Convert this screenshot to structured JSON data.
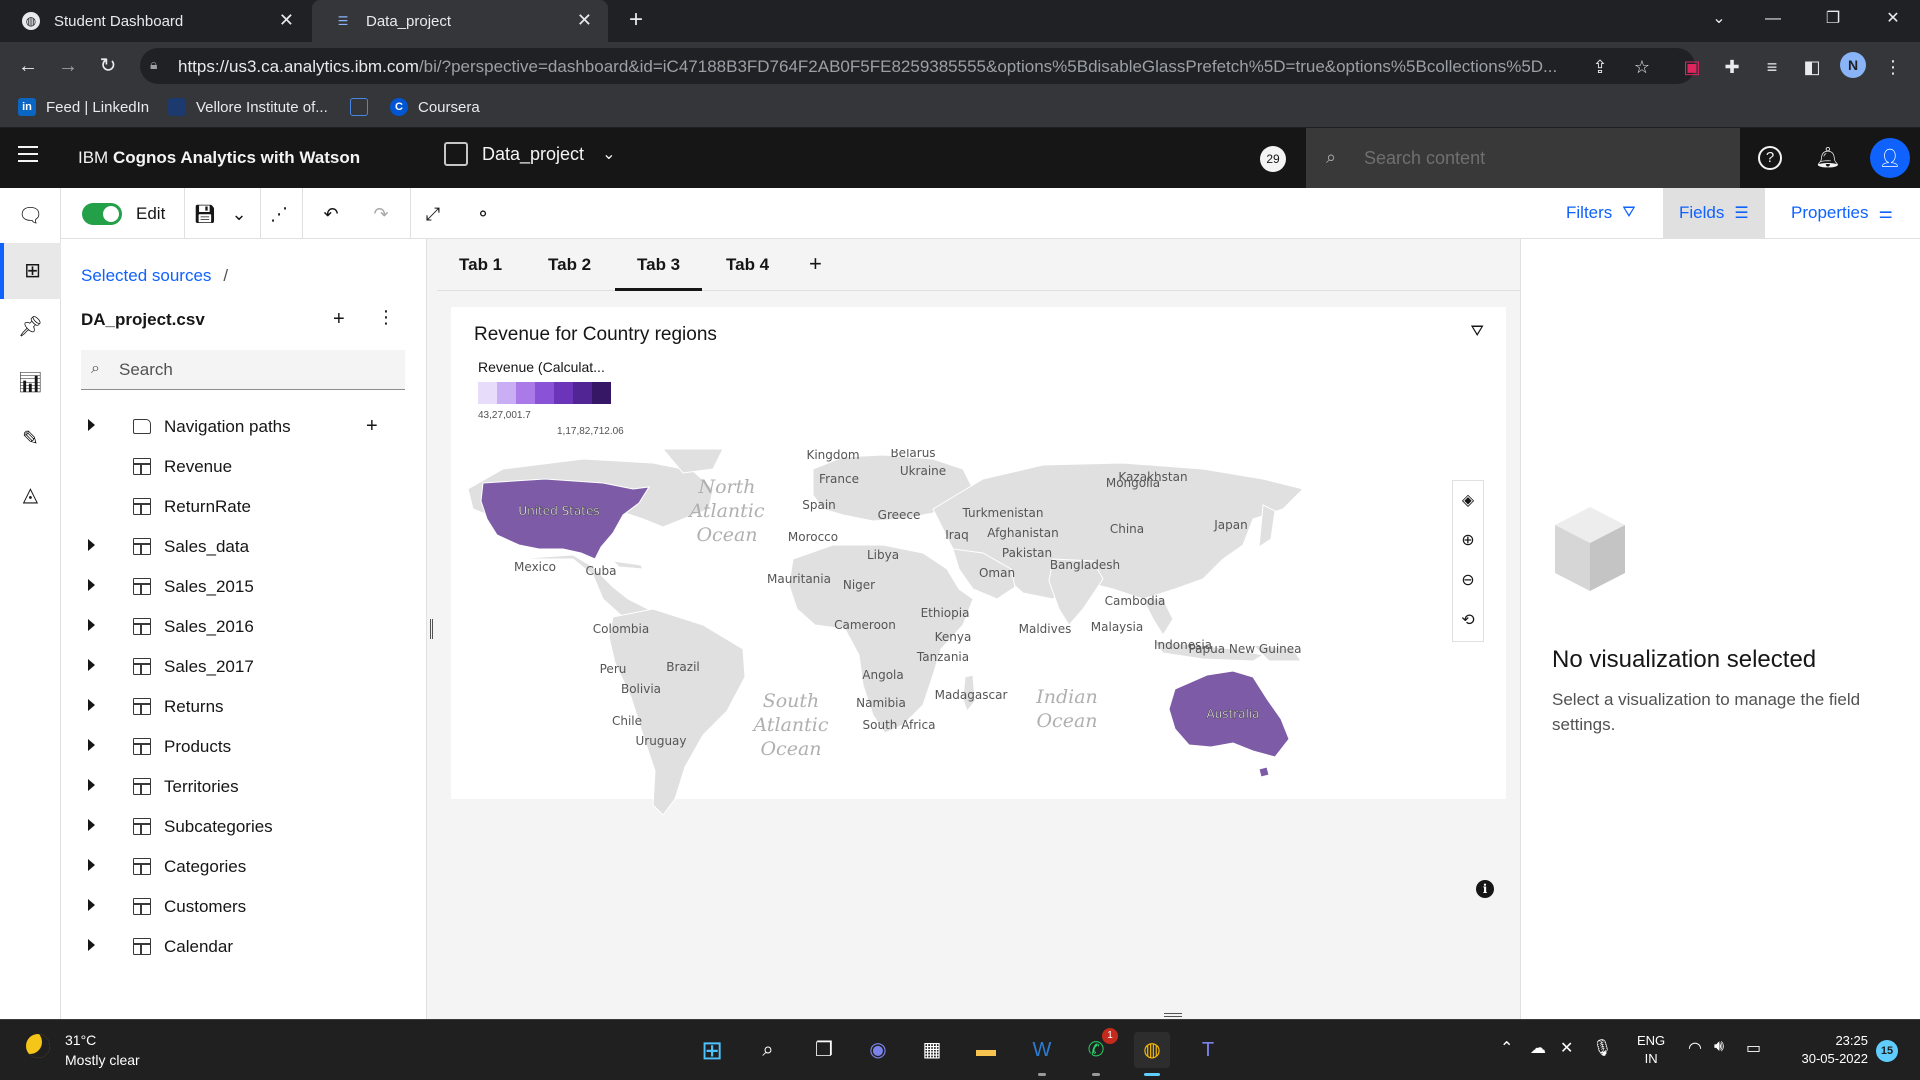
{
  "browser": {
    "tabs": [
      {
        "title": "Student Dashboard",
        "active": false
      },
      {
        "title": "Data_project",
        "active": true
      }
    ],
    "url_host": "https://us3.ca.analytics.ibm.com",
    "url_path": "/bi/?perspective=dashboard&id=iC47188B3FD764F2AB0F5FE8259385555&options%5BdisableGlassPrefetch%5D=true&options%5Bcollections%5D...",
    "profile_initial": "N",
    "bookmarks": [
      {
        "label": "Feed | LinkedIn",
        "icon": "in"
      },
      {
        "label": "Vellore Institute of...",
        "icon": ""
      },
      {
        "label": "",
        "icon": ""
      },
      {
        "label": "Coursera",
        "icon": "C"
      }
    ]
  },
  "app": {
    "product_name_prefix": "IBM ",
    "product_name": "Cognos Analytics with Watson",
    "project_name": "Data_project",
    "notification_count": "29",
    "search_placeholder": "Search content",
    "user_icon": "user-avatar-icon"
  },
  "editbar": {
    "edit_label": "Edit",
    "filters_label": "Filters",
    "fields_label": "Fields",
    "properties_label": "Properties"
  },
  "sources": {
    "breadcrumb": "Selected sources",
    "breadcrumb_sep": "/",
    "source_name": "DA_project.csv",
    "search_placeholder": "Search",
    "tree": [
      {
        "label": "Navigation paths",
        "type": "folder",
        "expandable": true
      },
      {
        "label": "Revenue",
        "type": "calc",
        "expandable": false
      },
      {
        "label": "ReturnRate",
        "type": "calc",
        "expandable": false
      },
      {
        "label": "Sales_data",
        "type": "table",
        "expandable": true
      },
      {
        "label": "Sales_2015",
        "type": "table",
        "expandable": true
      },
      {
        "label": "Sales_2016",
        "type": "table",
        "expandable": true
      },
      {
        "label": "Sales_2017",
        "type": "table",
        "expandable": true
      },
      {
        "label": "Returns",
        "type": "table",
        "expandable": true
      },
      {
        "label": "Products",
        "type": "table",
        "expandable": true
      },
      {
        "label": "Territories",
        "type": "table",
        "expandable": true
      },
      {
        "label": "Subcategories",
        "type": "table",
        "expandable": true
      },
      {
        "label": "Categories",
        "type": "table",
        "expandable": true
      },
      {
        "label": "Customers",
        "type": "table",
        "expandable": true
      },
      {
        "label": "Calendar",
        "type": "table",
        "expandable": true
      }
    ]
  },
  "canvas": {
    "tabs": [
      "Tab 1",
      "Tab 2",
      "Tab 3",
      "Tab 4"
    ],
    "active_tab": "Tab 3",
    "widget": {
      "title": "Revenue for Country regions",
      "legend_title": "Revenue (Calculat...",
      "legend_min": "43,27,001.7",
      "legend_max": "1,17,82,712.06",
      "legend_colors": [
        "#e8dcfb",
        "#c9adf5",
        "#a97ae8",
        "#8a52d6",
        "#6c34b8",
        "#512593",
        "#361766"
      ],
      "highlight_color": "#7d5ba6",
      "land_color": "#e0e0e0",
      "map_labels": {
        "countries": [
          "Kingdom",
          "Belarus",
          "Ukraine",
          "France",
          "Kazakhstan",
          "Mongolia",
          "Spain",
          "Greece",
          "Turkmenistan",
          "Japan",
          "Afghanistan",
          "Iraq",
          "China",
          "Morocco",
          "Libya",
          "Pakistan",
          "Bangladesh",
          "Oman",
          "Mauritania",
          "Niger",
          "Cambodia",
          "Ethiopia",
          "Cameroon",
          "Maldives",
          "Malaysia",
          "Kenya",
          "Indonesia",
          "Papua New Guinea",
          "Tanzania",
          "Angola",
          "Madagascar",
          "Namibia",
          "South Africa",
          "Mexico",
          "Cuba",
          "Colombia",
          "Brazil",
          "Peru",
          "Bolivia",
          "Chile",
          "Uruguay"
        ],
        "highlighted": [
          "United States",
          "Australia"
        ],
        "oceans": [
          "North Atlantic Ocean",
          "South Atlantic Ocean",
          "Indian Ocean"
        ]
      }
    }
  },
  "properties": {
    "empty_title": "No visualization selected",
    "empty_desc": "Select a visualization to manage the field settings."
  },
  "taskbar": {
    "temperature": "31°C",
    "weather": "Mostly clear",
    "whatsapp_badge": "1",
    "lang_line1": "ENG",
    "lang_line2": "IN",
    "time": "23:25",
    "date": "30-05-2022",
    "notifications": "15"
  }
}
